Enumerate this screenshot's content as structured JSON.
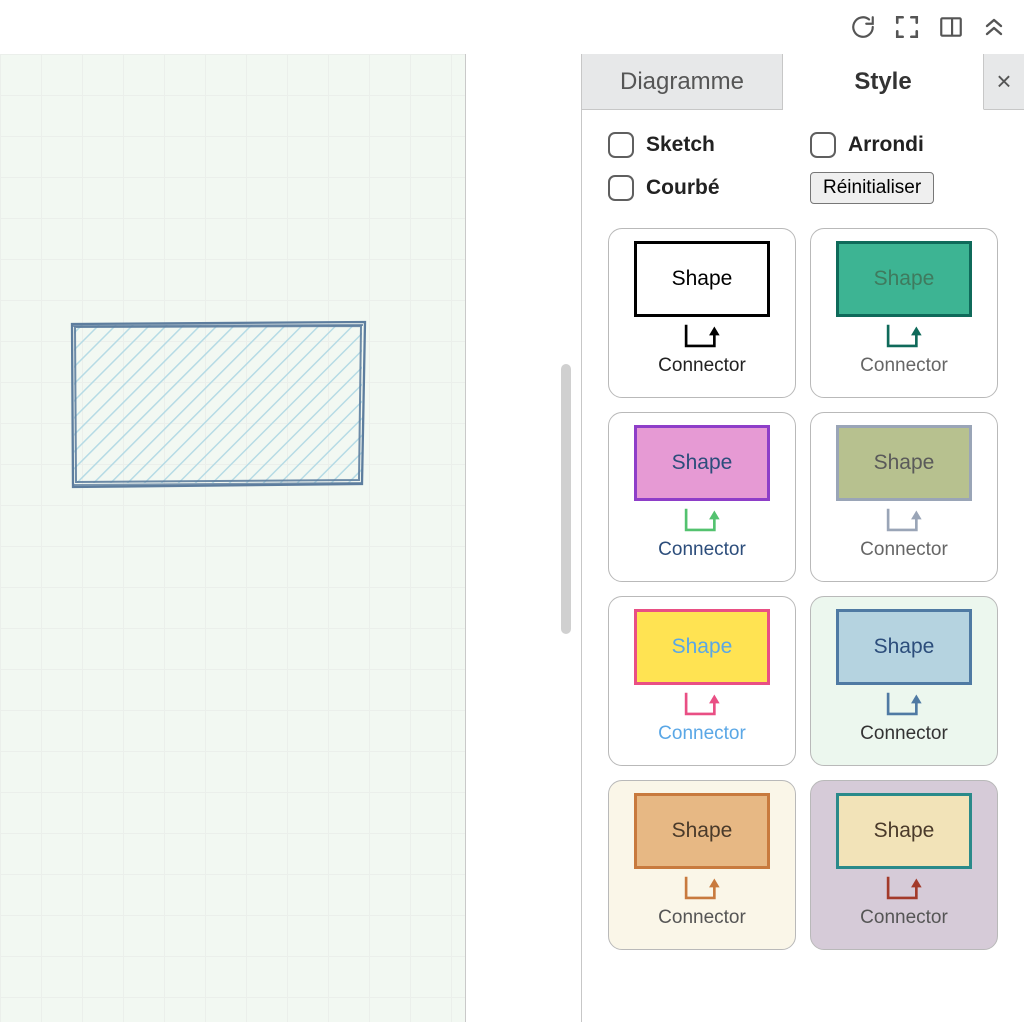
{
  "topbar": {
    "icons": [
      "refresh-icon",
      "fullscreen-icon",
      "toggle-panel-icon",
      "collapse-icon"
    ]
  },
  "tabs": {
    "diagram": "Diagramme",
    "style": "Style",
    "active": "style"
  },
  "options": {
    "sketch": "Sketch",
    "arrondi": "Arrondi",
    "courbe": "Courbé",
    "reset": "Réinitialiser"
  },
  "swatches": [
    {
      "shape": "Shape",
      "connector": "Connector",
      "bg": "#ffffff",
      "fill": "#ffffff",
      "border": "#000000",
      "shapeText": "#000000",
      "conn": "#000000",
      "connText": "#222222"
    },
    {
      "shape": "Shape",
      "connector": "Connector",
      "bg": "#ffffff",
      "fill": "#3db493",
      "border": "#0f6a5a",
      "shapeText": "#3f7a5e",
      "conn": "#0f6a5a",
      "connText": "#666666"
    },
    {
      "shape": "Shape",
      "connector": "Connector",
      "bg": "#ffffff",
      "fill": "#e69ad4",
      "border": "#8e3ec8",
      "shapeText": "#2c4d7b",
      "conn": "#53c26f",
      "connText": "#2c4d7b"
    },
    {
      "shape": "Shape",
      "connector": "Connector",
      "bg": "#ffffff",
      "fill": "#b7c18f",
      "border": "#9aa5b7",
      "shapeText": "#5a5a5a",
      "conn": "#9aa5b7",
      "connText": "#666666"
    },
    {
      "shape": "Shape",
      "connector": "Connector",
      "bg": "#ffffff",
      "fill": "#ffe352",
      "border": "#e94f84",
      "shapeText": "#5aa7e6",
      "conn": "#e94f84",
      "connText": "#5aa7e6"
    },
    {
      "shape": "Shape",
      "connector": "Connector",
      "bg": "#ecf7ee",
      "fill": "#b5d3e0",
      "border": "#4f7aa3",
      "shapeText": "#2c4d7b",
      "conn": "#4f7aa3",
      "connText": "#333333"
    },
    {
      "shape": "Shape",
      "connector": "Connector",
      "bg": "#faf6e8",
      "fill": "#e7b884",
      "border": "#c87a3e",
      "shapeText": "#4a3a2a",
      "conn": "#c87a3e",
      "connText": "#555555"
    },
    {
      "shape": "Shape",
      "connector": "Connector",
      "bg": "#d6cbd8",
      "fill": "#f2e3b8",
      "border": "#2a8a8a",
      "shapeText": "#4a3a2a",
      "conn": "#a33a2a",
      "connText": "#555555"
    }
  ],
  "canvas": {
    "shape_fill": "#b6dbe5",
    "shape_stroke": "#5d7d9e"
  }
}
